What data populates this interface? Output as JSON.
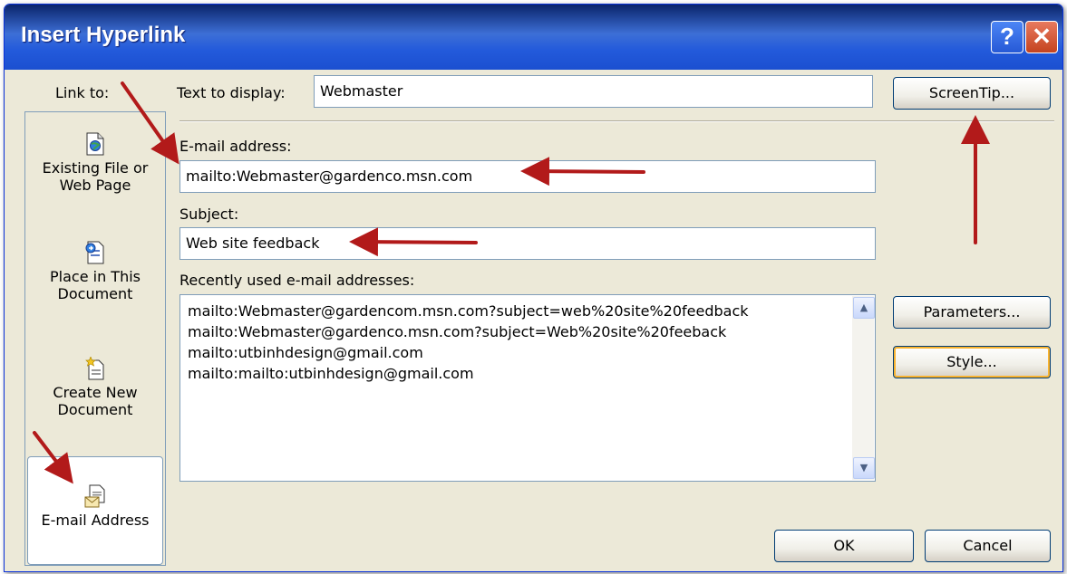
{
  "window": {
    "title": "Insert Hyperlink",
    "help_label": "?",
    "close_label": "✕"
  },
  "link_to": {
    "label": "Link to:",
    "items": [
      {
        "line1": "Existing File or",
        "line2": "Web Page",
        "icon": "existing-file-icon"
      },
      {
        "line1": "Place in This",
        "line2": "Document",
        "icon": "place-in-document-icon"
      },
      {
        "line1": "Create New",
        "line2": "Document",
        "icon": "create-new-document-icon"
      },
      {
        "line1": "E-mail Address",
        "line2": "",
        "icon": "email-address-icon"
      }
    ]
  },
  "text_to_display": {
    "label": "Text to display:",
    "value": "Webmaster"
  },
  "email_address": {
    "label": "E-mail address:",
    "value": "mailto:Webmaster@gardenco.msn.com"
  },
  "subject": {
    "label": "Subject:",
    "value": "Web site feedback"
  },
  "recent": {
    "label": "Recently used e-mail addresses:",
    "items": [
      "mailto:Webmaster@gardencom.msn.com?subject=web%20site%20feedback",
      "mailto:Webmaster@gardenco.msn.com?subject=Web%20site%20feeback",
      "mailto:utbinhdesign@gmail.com",
      "mailto:mailto:utbinhdesign@gmail.com"
    ]
  },
  "buttons": {
    "screentip": "ScreenTip...",
    "parameters": "Parameters...",
    "style": "Style...",
    "ok": "OK",
    "cancel": "Cancel"
  },
  "colors": {
    "dialog_bg": "#ECE9D8",
    "titlebar": "#235ADB",
    "annotation_arrow": "#B21A1A"
  }
}
